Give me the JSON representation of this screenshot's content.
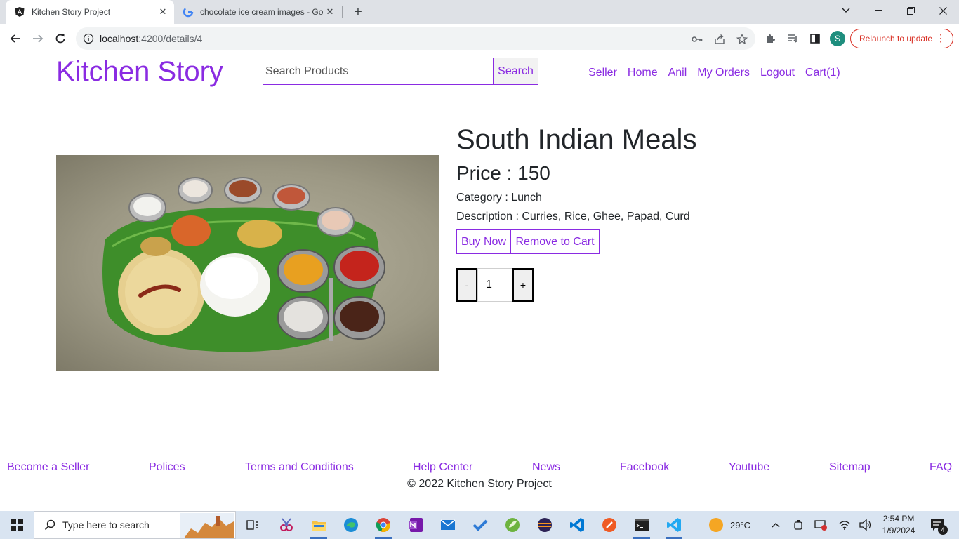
{
  "browser": {
    "tabs": [
      {
        "title": "Kitchen Story Project",
        "favicon": "angular-icon"
      },
      {
        "title": "chocolate ice cream images - Go",
        "favicon": "google-icon"
      }
    ],
    "url_host": "localhost",
    "url_path": ":4200/details/4",
    "profile_initial": "S",
    "relaunch_label": "Relaunch to update"
  },
  "header": {
    "logo": "Kitchen Story",
    "search_placeholder": "Search Products",
    "search_button": "Search",
    "nav": [
      "Seller",
      "Home",
      "Anil",
      "My Orders",
      "Logout",
      "Cart(1)"
    ]
  },
  "product": {
    "name": "South Indian Meals",
    "price_text": "Price : 150",
    "category_text": "Category : Lunch",
    "description_text": "Description : Curries, Rice, Ghee, Papad, Curd",
    "buy_button": "Buy Now",
    "remove_button": "Remove to Cart",
    "qty_minus": "-",
    "qty_plus": "+",
    "quantity": "1"
  },
  "footer": {
    "links": [
      "Become a Seller",
      "Polices",
      "Terms and Conditions",
      "Help Center",
      "News",
      "Facebook",
      "Youtube",
      "Sitemap",
      "FAQ"
    ],
    "copyright": "© 2022 Kitchen Story Project"
  },
  "taskbar": {
    "search_placeholder": "Type here to search",
    "temperature": "29°C",
    "time": "2:54 PM",
    "date": "1/9/2024",
    "notification_count": "4"
  },
  "colors": {
    "brand": "#8a2be2",
    "text": "#212529"
  }
}
